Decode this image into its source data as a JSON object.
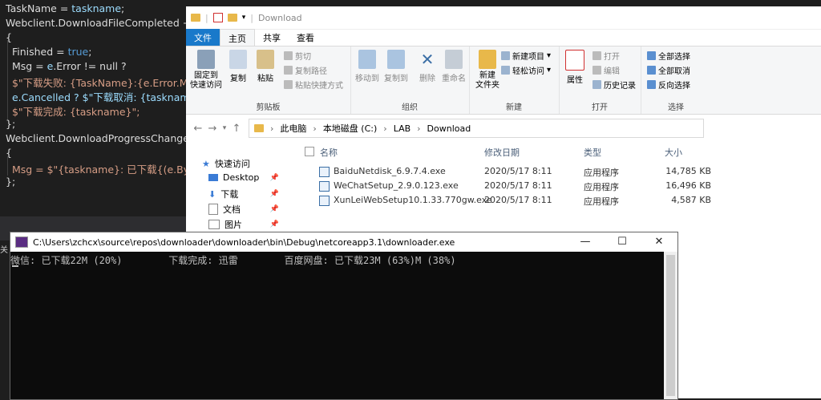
{
  "editor": {
    "lines": [
      {
        "a": "TaskName = ",
        "b": "taskname",
        "c": ";"
      },
      {
        "a": "Webclient.DownloadFileCompleted +=",
        "b": "",
        "c": ""
      },
      {
        "a": "{",
        "b": "",
        "c": ""
      },
      {
        "a": "  Finished = ",
        "b": "true",
        "c": ";"
      },
      {
        "a": "  Msg = ",
        "b": "e",
        "c": ".Error != null ?"
      },
      {
        "a": "  $\"下载失败: {TaskName}:{e.Error.Mes",
        "b": "",
        "c": ""
      },
      {
        "a": "  e.Cancelled ? $\"下载取消: {taskname}",
        "b": "",
        "c": ""
      },
      {
        "a": "  $\"下载完成: {taskname}\";",
        "b": "",
        "c": ""
      },
      {
        "a": "};",
        "b": "",
        "c": ""
      },
      {
        "a": "Webclient.DownloadProgressChanged",
        "b": "",
        "c": ""
      },
      {
        "a": "{",
        "b": "",
        "c": ""
      },
      {
        "a": "  Msg = $\"{taskname}: 已下载{(e.Byte",
        "b": "",
        "c": ""
      },
      {
        "a": "};",
        "b": "",
        "c": ""
      }
    ],
    "bottom_char": "关"
  },
  "explorer": {
    "title": "Download",
    "tabs": {
      "file": "文件",
      "home": "主页",
      "share": "共享",
      "view": "查看"
    },
    "ribbon": {
      "pin": "固定到\n快速访问",
      "copy": "复制",
      "paste": "粘贴",
      "cut": "剪切",
      "copy_path": "复制路径",
      "paste_shortcut": "粘贴快捷方式",
      "clipboard": "剪贴板",
      "move_to": "移动到",
      "copy_to": "复制到",
      "delete": "删除",
      "rename": "重命名",
      "organize": "组织",
      "new_folder": "新建\n文件夹",
      "new_item": "新建项目",
      "easy_access": "轻松访问",
      "new": "新建",
      "properties": "属性",
      "open": "打开",
      "edit": "编辑",
      "history": "历史记录",
      "open_group": "打开",
      "select_all": "全部选择",
      "select_none": "全部取消",
      "invert": "反向选择",
      "select_group": "选择"
    },
    "breadcrumb": [
      "此电脑",
      "本地磁盘 (C:)",
      "LAB",
      "Download"
    ],
    "nav": [
      {
        "label": "快速访问"
      },
      {
        "label": "Desktop"
      },
      {
        "label": "下载"
      },
      {
        "label": "文档"
      },
      {
        "label": "图片"
      }
    ],
    "columns": {
      "name": "名称",
      "date": "修改日期",
      "type": "类型",
      "size": "大小"
    },
    "files": [
      {
        "name": "BaiduNetdisk_6.9.7.4.exe",
        "date": "2020/5/17 8:11",
        "type": "应用程序",
        "size": "14,785 KB"
      },
      {
        "name": "WeChatSetup_2.9.0.123.exe",
        "date": "2020/5/17 8:11",
        "type": "应用程序",
        "size": "16,496 KB"
      },
      {
        "name": "XunLeiWebSetup10.1.33.770gw.exe",
        "date": "2020/5/17 8:11",
        "type": "应用程序",
        "size": "4,587 KB"
      }
    ]
  },
  "console": {
    "title": "C:\\Users\\zchcx\\source\\repos\\downloader\\downloader\\bin\\Debug\\netcoreapp3.1\\downloader.exe",
    "output": "微信: 已下载22M (20%)        下载完成: 迅雷        百度网盘: 已下载23M (63%)M (38%)",
    "minimize": "—",
    "maximize": "☐",
    "close": "✕"
  }
}
